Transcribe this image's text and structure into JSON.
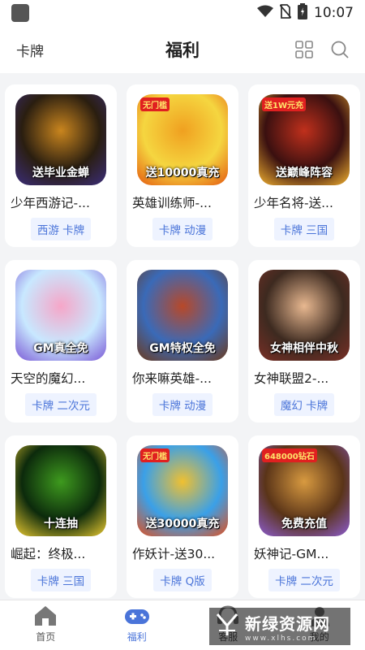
{
  "status_bar": {
    "time": "10:07"
  },
  "header": {
    "left_label": "卡牌",
    "title": "福利"
  },
  "games": [
    {
      "name": "少年西游记-...",
      "tags": "西游 卡牌",
      "banner": "送毕业金蝉",
      "badge": "",
      "colors": [
        "#2a1e10",
        "#c9851e",
        "#3b2d7a"
      ]
    },
    {
      "name": "英雄训练师-...",
      "tags": "卡牌 动漫",
      "banner": "送10000真充",
      "badge": "无门槛",
      "colors": [
        "#f5d640",
        "#f0a020",
        "#e45a10"
      ]
    },
    {
      "name": "少年名将-送...",
      "tags": "卡牌 三国",
      "banner": "送巅峰阵容",
      "badge": "送1W元充",
      "colors": [
        "#3a1010",
        "#c0301c",
        "#f0b030"
      ]
    },
    {
      "name": "天空的魔幻...",
      "tags": "卡牌 二次元",
      "banner": "GM真全免",
      "badge": "",
      "colors": [
        "#c8e8ff",
        "#f6a6c8",
        "#7b5ad6"
      ]
    },
    {
      "name": "你来嘛英雄-...",
      "tags": "卡牌 动漫",
      "banner": "GM特权全免",
      "badge": "",
      "colors": [
        "#3a6ab8",
        "#b84828",
        "#6c3a1c"
      ]
    },
    {
      "name": "女神联盟2-...",
      "tags": "魔幻 卡牌",
      "banner": "女神相伴中秋",
      "badge": "",
      "colors": [
        "#3d2a20",
        "#e8b890",
        "#7a2f26"
      ]
    },
    {
      "name": "崛起：终极...",
      "tags": "卡牌 三国",
      "banner": "十连抽",
      "badge": "",
      "colors": [
        "#0c2a0c",
        "#3e9a1e",
        "#e8c830"
      ]
    },
    {
      "name": "作妖计-送30...",
      "tags": "卡牌 Q版",
      "banner": "送30000真充",
      "badge": "无门槛",
      "colors": [
        "#3aa0e8",
        "#f0c030",
        "#e05020"
      ]
    },
    {
      "name": "妖神记-GM...",
      "tags": "卡牌 二次元",
      "banner": "免费充值",
      "badge": "648000钻石",
      "colors": [
        "#5a3418",
        "#d89a40",
        "#8c5cd0"
      ]
    }
  ],
  "tabs": [
    {
      "label": "首页",
      "icon": "home-icon"
    },
    {
      "label": "福利",
      "icon": "gamepad-icon"
    },
    {
      "label": "客服",
      "icon": "service-icon"
    },
    {
      "label": "我的",
      "icon": "user-icon"
    }
  ],
  "watermark": {
    "main": "新绿资源网",
    "sub": "www.xlhs.com"
  },
  "colors": {
    "accent": "#4a74d9",
    "tag_bg": "#eef3ff",
    "page_bg": "#f3f4f6"
  }
}
